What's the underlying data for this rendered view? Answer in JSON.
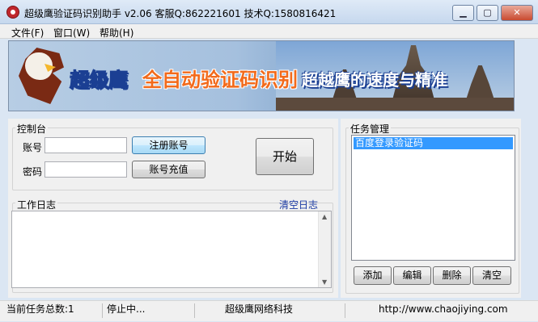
{
  "window": {
    "title": "超级鹰验证码识别助手 v2.06   客服Q:862221601   技术Q:1580816421",
    "min_label": "▁",
    "max_label": "▢",
    "close_label": "✕"
  },
  "menu": {
    "items": [
      "文件(F)",
      "窗口(W)",
      "帮助(H)"
    ]
  },
  "banner": {
    "brand": "超级鹰",
    "slogan1": "全自动验证码识别",
    "slogan2": "超越鹰的速度与精准"
  },
  "console": {
    "group_label": "控制台",
    "account_label": "账号",
    "account_value": "",
    "password_label": "密码",
    "password_value": "",
    "register_button": "注册账号",
    "recharge_button": "账号充值",
    "start_button": "开始"
  },
  "log": {
    "group_label": "工作日志",
    "clear_link": "清空日志",
    "content": ""
  },
  "tasks": {
    "group_label": "任务管理",
    "items": [
      "百度登录验证码"
    ],
    "add_button": "添加",
    "edit_button": "编辑",
    "delete_button": "删除",
    "clear_button": "清空"
  },
  "status": {
    "task_count": "当前任务总数:1",
    "state": "停止中...",
    "company": "超级鹰网络科技",
    "url": "http://www.chaojiying.com"
  }
}
